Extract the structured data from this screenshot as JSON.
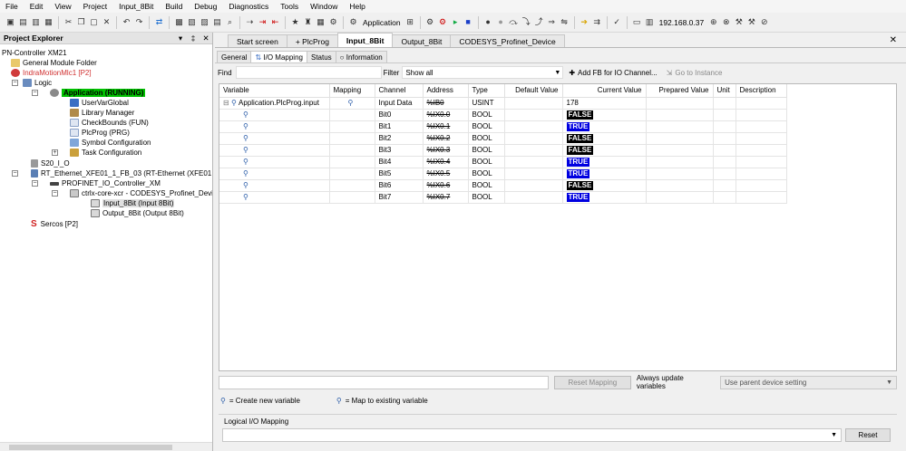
{
  "menu": [
    "File",
    "Edit",
    "View",
    "Project",
    "Input_8Bit",
    "Build",
    "Debug",
    "Diagnostics",
    "Tools",
    "Window",
    "Help"
  ],
  "toolbar": {
    "application_label": "Application",
    "ip_address": "192.168.0.37"
  },
  "project_explorer": {
    "title": "Project Explorer",
    "controls": [
      "▾",
      "‡",
      "✕"
    ],
    "nodes": [
      {
        "label": "PN-Controller XM21"
      },
      {
        "label": "General Module Folder"
      },
      {
        "label": "IndraMotionMlc1 [P2]"
      },
      {
        "label": "Logic"
      },
      {
        "label": "Application (RUNNING)"
      },
      {
        "label": "UserVarGlobal"
      },
      {
        "label": "Library Manager"
      },
      {
        "label": "CheckBounds (FUN)"
      },
      {
        "label": "PlcProg (PRG)"
      },
      {
        "label": "Symbol Configuration"
      },
      {
        "label": "Task Configuration"
      },
      {
        "label": "S20_I_O"
      },
      {
        "label": "RT_Ethernet_XFE01_1_FB_03 (RT-Ethernet (XFE01.1-"
      },
      {
        "label": "PROFINET_IO_Controller_XM"
      },
      {
        "label": "ctrlx-core-xcr - CODESYS_Profinet_Device"
      },
      {
        "label": "Input_8Bit (Input 8Bit)"
      },
      {
        "label": "Output_8Bit (Output 8Bit)"
      },
      {
        "label": "Sercos [P2]"
      }
    ]
  },
  "doc_tabs": [
    "Start screen",
    "PlcProg",
    "Input_8Bit",
    "Output_8Bit",
    "CODESYS_Profinet_Device"
  ],
  "sub_tabs": [
    "General",
    "I/O Mapping",
    "Status",
    "Information"
  ],
  "find_label": "Find",
  "filter_label": "Filter",
  "filter_value": "Show all",
  "add_fb_label": "Add FB for IO Channel...",
  "goto_label": "Go to Instance",
  "columns": [
    "Variable",
    "Mapping",
    "Channel",
    "Address",
    "Type",
    "Default Value",
    "Current Value",
    "Prepared Value",
    "Unit",
    "Description"
  ],
  "rows": [
    {
      "variable": "Application.PlcProg.input",
      "channel": "Input Data",
      "address": "%IB0",
      "type": "USINT",
      "current": "178",
      "kind": "plain"
    },
    {
      "variable": "",
      "channel": "Bit0",
      "address": "%IX0.0",
      "type": "BOOL",
      "current": "FALSE",
      "kind": "false"
    },
    {
      "variable": "",
      "channel": "Bit1",
      "address": "%IX0.1",
      "type": "BOOL",
      "current": "TRUE",
      "kind": "true"
    },
    {
      "variable": "",
      "channel": "Bit2",
      "address": "%IX0.2",
      "type": "BOOL",
      "current": "FALSE",
      "kind": "false"
    },
    {
      "variable": "",
      "channel": "Bit3",
      "address": "%IX0.3",
      "type": "BOOL",
      "current": "FALSE",
      "kind": "false"
    },
    {
      "variable": "",
      "channel": "Bit4",
      "address": "%IX0.4",
      "type": "BOOL",
      "current": "TRUE",
      "kind": "true"
    },
    {
      "variable": "",
      "channel": "Bit5",
      "address": "%IX0.5",
      "type": "BOOL",
      "current": "TRUE",
      "kind": "true"
    },
    {
      "variable": "",
      "channel": "Bit6",
      "address": "%IX0.6",
      "type": "BOOL",
      "current": "FALSE",
      "kind": "false"
    },
    {
      "variable": "",
      "channel": "Bit7",
      "address": "%IX0.7",
      "type": "BOOL",
      "current": "TRUE",
      "kind": "true"
    }
  ],
  "reset_mapping_label": "Reset Mapping",
  "always_update_label": "Always update variables",
  "always_update_value": "Use parent device setting",
  "legend": {
    "create": "= Create new variable",
    "map": "= Map to existing variable"
  },
  "logical_mapping_label": "Logical I/O Mapping",
  "reset_label": "Reset",
  "colors": {
    "true_bg": "#0000e0",
    "false_bg": "#000000",
    "running": "#00c000"
  }
}
